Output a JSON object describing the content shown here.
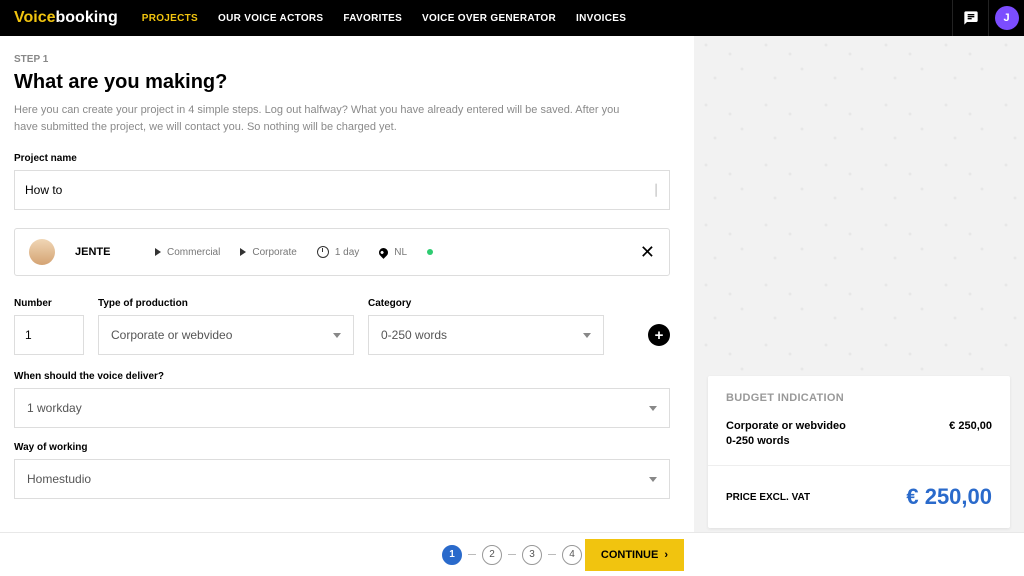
{
  "logo": {
    "voice": "Voice",
    "booking": "booking"
  },
  "nav": {
    "projects": "PROJECTS",
    "actors": "OUR VOICE ACTORS",
    "favorites": "FAVORITES",
    "generator": "VOICE OVER GENERATOR",
    "invoices": "INVOICES"
  },
  "header": {
    "avatar_initial": "J"
  },
  "step": {
    "label": "STEP 1",
    "heading": "What are you making?",
    "subtext": "Here you can create your project in 4 simple steps. Log out halfway? What you have already entered will be saved. After you have submitted the project, we will contact you. So nothing will be charged yet."
  },
  "form": {
    "project_name_label": "Project name",
    "project_name_value": "How to",
    "number_label": "Number",
    "number_value": "1",
    "prod_label": "Type of production",
    "prod_value": "Corporate or webvideo",
    "cat_label": "Category",
    "cat_value": "0-250 words",
    "deliver_label": "When should the voice deliver?",
    "deliver_value": "1 workday",
    "way_label": "Way of working",
    "way_value": "Homestudio"
  },
  "actor": {
    "name": "JENTE",
    "sample1": "Commercial",
    "sample2": "Corporate",
    "duration": "1 day",
    "country": "NL"
  },
  "budget": {
    "header": "BUDGET INDICATION",
    "line1": "Corporate or webvideo",
    "line2": "0-250 words",
    "line_price": "€ 250,00",
    "total_label": "PRICE EXCL. VAT",
    "total_price": "€ 250,00"
  },
  "footer": {
    "step1": "1",
    "step2": "2",
    "step3": "3",
    "step4": "4",
    "continue": "CONTINUE"
  }
}
